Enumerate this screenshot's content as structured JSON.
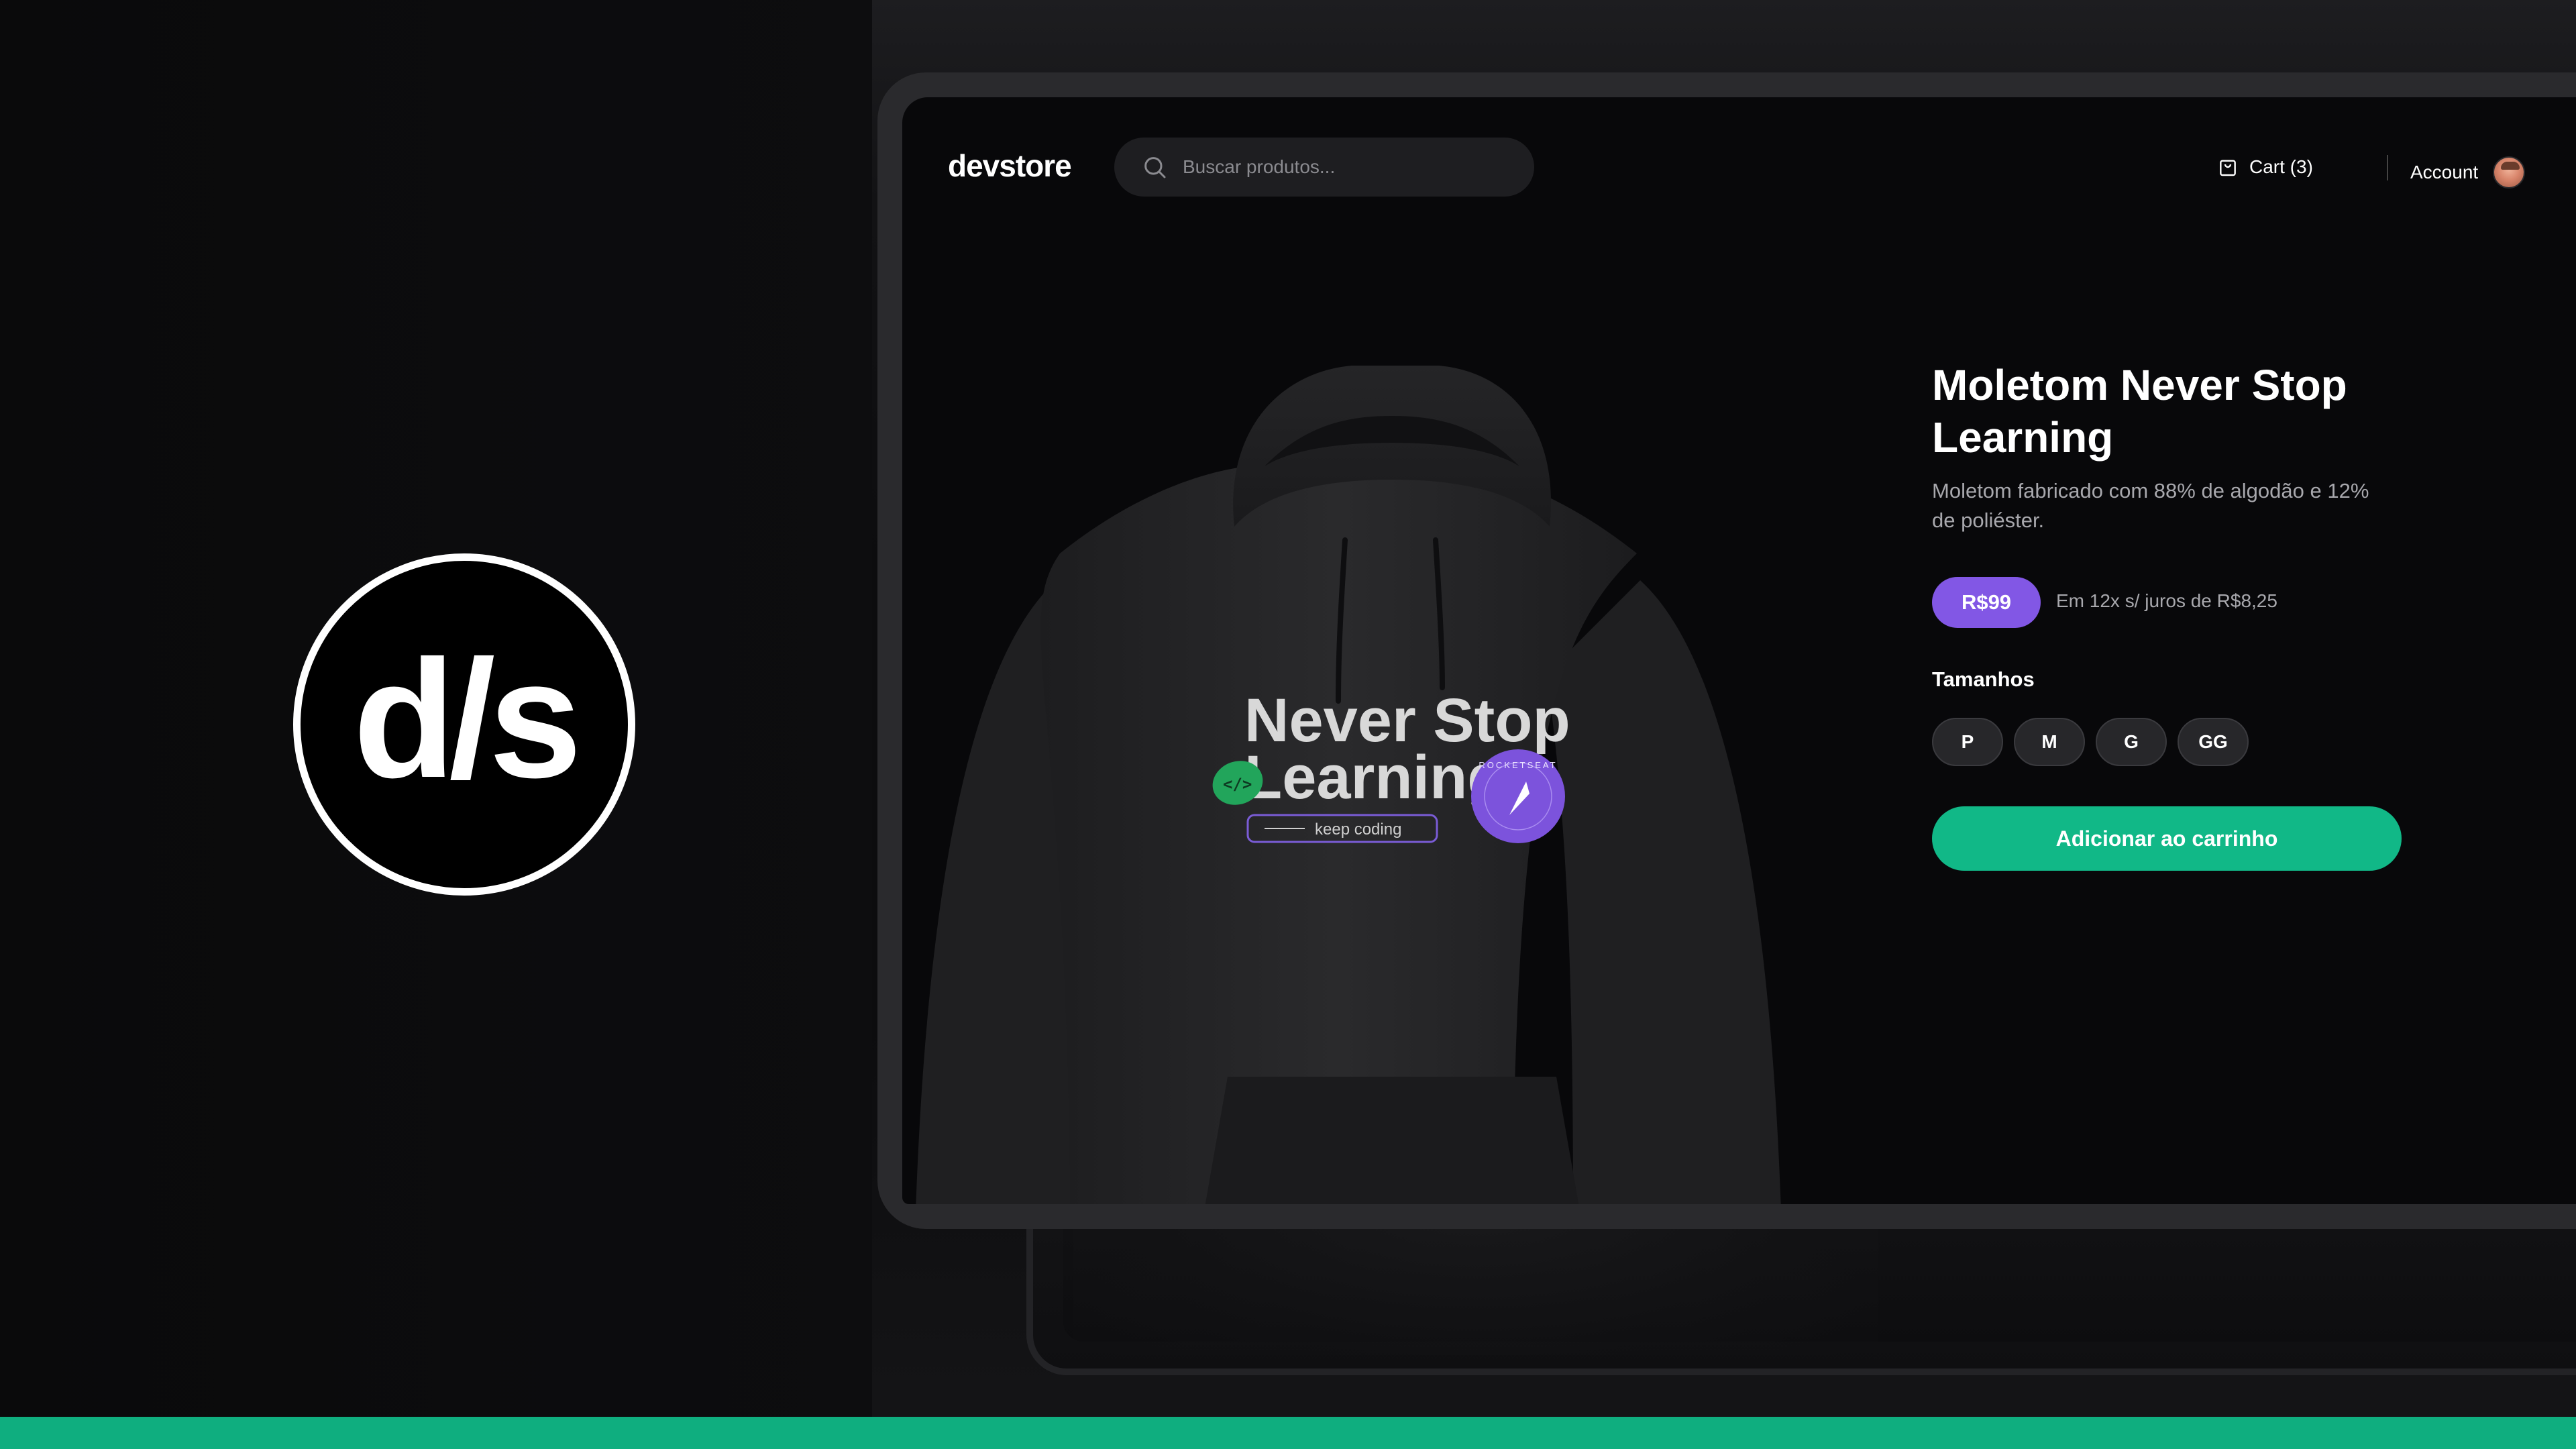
{
  "logo": {
    "text": "d/s"
  },
  "header": {
    "brand": "devstore",
    "search_placeholder": "Buscar produtos...",
    "cart_label": "Cart (3)",
    "account_label": "Account"
  },
  "product": {
    "print": {
      "line1": "Never Stop",
      "line2": "Learning",
      "tag": "keep coding",
      "badge_text": "ROCKETSEAT",
      "code_sticker": "</>"
    },
    "title": "Moletom Never Stop Learning",
    "description": "Moletom fabricado com 88% de algodão e 12% de poliéster.",
    "price": "R$99",
    "installments": "Em 12x s/ juros de R$8,25",
    "sizes_label": "Tamanhos",
    "sizes": [
      "P",
      "M",
      "G",
      "GG"
    ],
    "add_to_cart": "Adicionar ao carrinho"
  },
  "colors": {
    "accent_green": "#11b887",
    "accent_purple": "#8257e5",
    "background": "#08080a",
    "surface": "#1e1e21"
  },
  "icons": {
    "search": "search-icon",
    "cart": "shopping-bag-icon",
    "rocket": "rocket-icon"
  }
}
